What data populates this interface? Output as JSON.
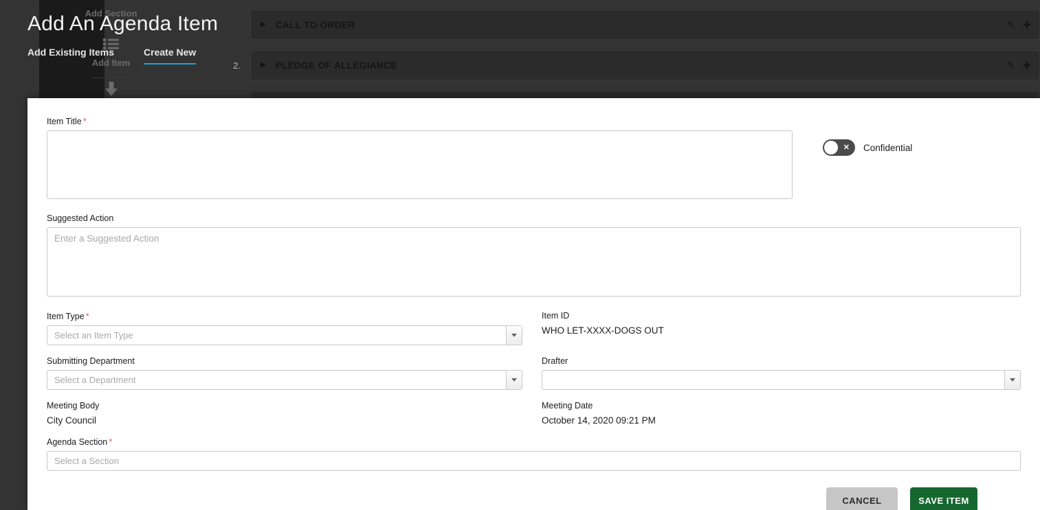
{
  "background": {
    "page_title": "Add An Agenda Item",
    "tabs": [
      {
        "label": "Add Existing Items",
        "active": false
      },
      {
        "label": "Create New",
        "active": true
      }
    ],
    "sidebar": {
      "add_section_label": "Add Section",
      "add_item_label": "Add Item",
      "list_icon": "list-icon",
      "download_icon": "download-icon"
    },
    "agenda_rows": [
      {
        "number": "",
        "label": "CALL TO ORDER",
        "edit_icon": "pencil-icon",
        "move_icon": "move-icon"
      },
      {
        "number": "2.",
        "label": "PLEDGE OF ALLEGIANCE",
        "edit_icon": "pencil-icon",
        "move_icon": "move-icon"
      }
    ],
    "accent_color": "#2a9fd8"
  },
  "modal": {
    "item_title": {
      "label": "Item Title",
      "required_marker": "*",
      "value": "",
      "placeholder": ""
    },
    "confidential": {
      "label": "Confidential",
      "state": "off",
      "off_glyph": "✕"
    },
    "suggested_action": {
      "label": "Suggested Action",
      "value": "",
      "placeholder": "Enter a Suggested Action"
    },
    "item_type": {
      "label": "Item Type",
      "required_marker": "*",
      "value": "",
      "placeholder": "Select an Item Type"
    },
    "item_id": {
      "label": "Item ID",
      "value": "WHO LET-XXXX-DOGS OUT"
    },
    "submitting_department": {
      "label": "Submitting Department",
      "value": "",
      "placeholder": "Select a Department"
    },
    "drafter": {
      "label": "Drafter",
      "value": "",
      "placeholder": ""
    },
    "meeting_body": {
      "label": "Meeting Body",
      "value": "City Council"
    },
    "meeting_date": {
      "label": "Meeting Date",
      "value": "October 14, 2020 09:21 PM"
    },
    "agenda_section": {
      "label": "Agenda Section",
      "required_marker": "*",
      "value": "",
      "placeholder": "Select a Section"
    },
    "buttons": {
      "cancel_label": "CANCEL",
      "save_label": "SAVE ITEM",
      "save_color": "#15672f",
      "cancel_color": "#c6c6c6"
    }
  }
}
